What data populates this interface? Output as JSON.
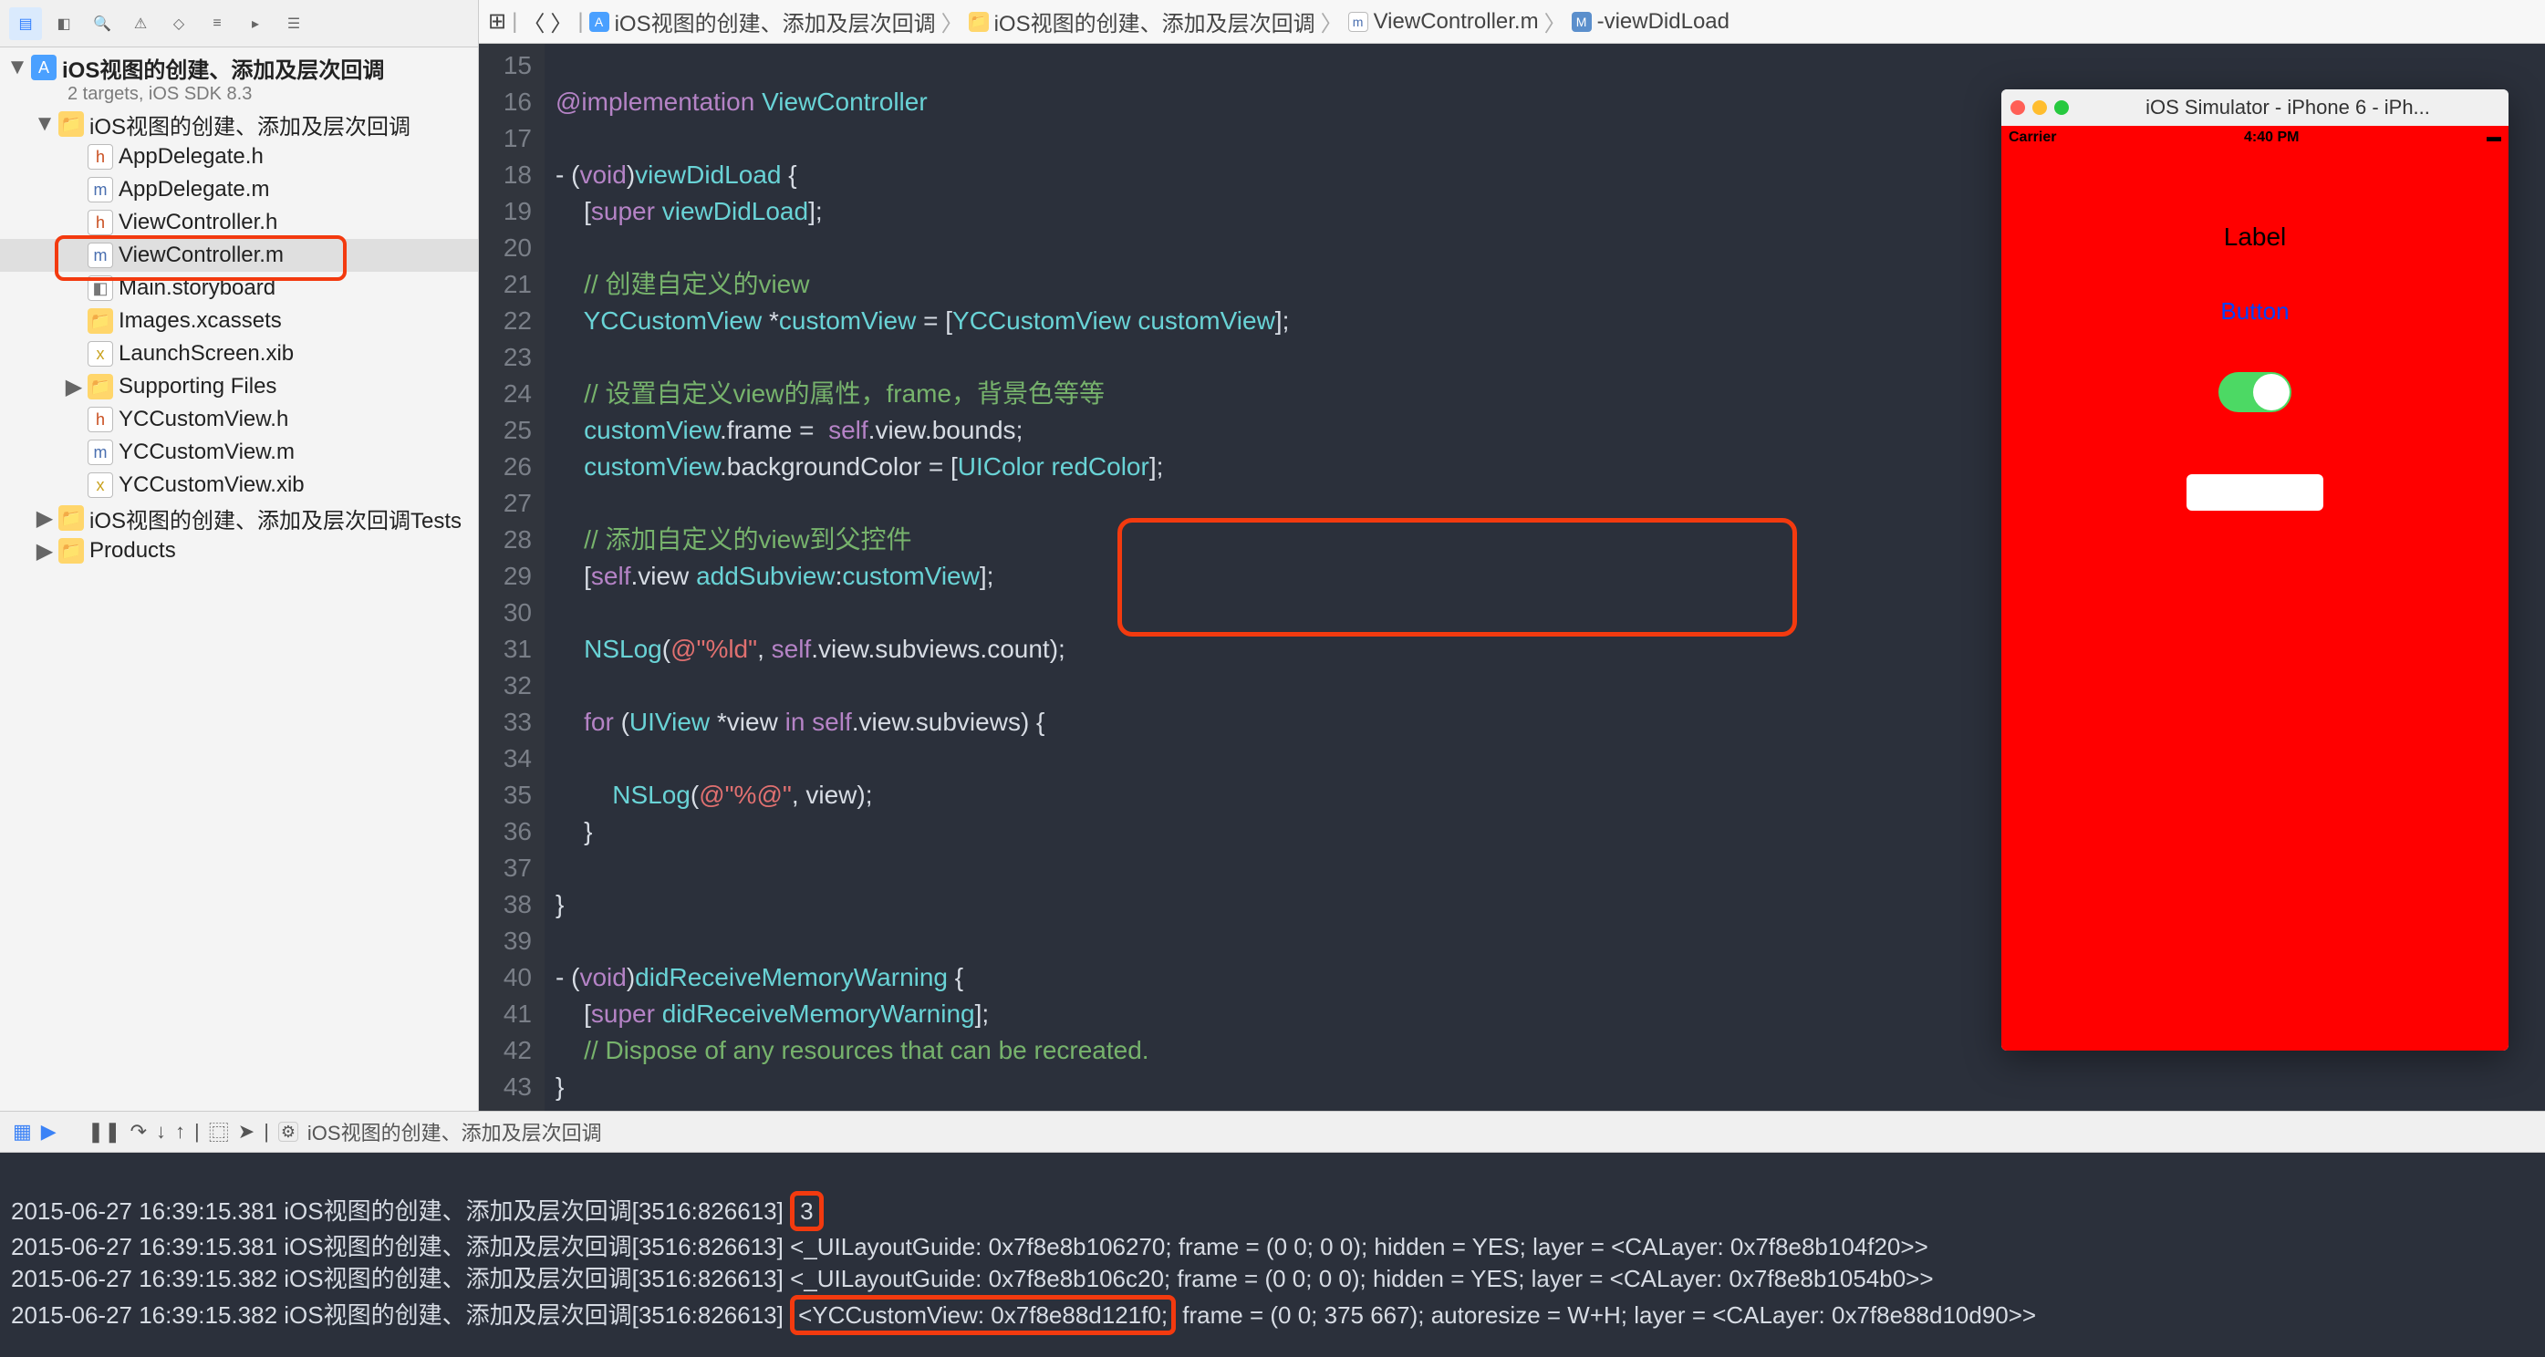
{
  "project": {
    "name": "iOS视图的创建、添加及层次回调",
    "subtitle": "2 targets, iOS SDK 8.3",
    "tree": {
      "root": "iOS视图的创建、添加及层次回调",
      "files": {
        "appdelegate_h": "AppDelegate.h",
        "appdelegate_m": "AppDelegate.m",
        "viewcontroller_h": "ViewController.h",
        "viewcontroller_m": "ViewController.m",
        "main_sb": "Main.storyboard",
        "images": "Images.xcassets",
        "launch": "LaunchScreen.xib",
        "supporting": "Supporting Files",
        "yc_h": "YCCustomView.h",
        "yc_m": "YCCustomView.m",
        "yc_xib": "YCCustomView.xib",
        "tests": "iOS视图的创建、添加及层次回调Tests",
        "products": "Products"
      }
    }
  },
  "jumpbar": {
    "item1": "iOS视图的创建、添加及层次回调",
    "item2": "iOS视图的创建、添加及层次回调",
    "item3": "ViewController.m",
    "item4": "-viewDidLoad"
  },
  "code": {
    "line_start": 15,
    "lines": [
      "",
      "@implementation ViewController",
      "",
      "- (void)viewDidLoad {",
      "    [super viewDidLoad];",
      "",
      "    // 创建自定义的view",
      "    YCCustomView *customView = [YCCustomView customView];",
      "",
      "    // 设置自定义view的属性，frame，背景色等等",
      "    customView.frame =  self.view.bounds;",
      "    customView.backgroundColor = [UIColor redColor];",
      "",
      "    // 添加自定义的view到父控件",
      "    [self.view addSubview:customView];",
      "",
      "    NSLog(@\"%ld\", self.view.subviews.count);",
      "",
      "    for (UIView *view in self.view.subviews) {",
      "",
      "        NSLog(@\"%@\", view);",
      "    }",
      "",
      "}",
      "",
      "- (void)didReceiveMemoryWarning {",
      "    [super didReceiveMemoryWarning];",
      "    // Dispose of any resources that can be recreated.",
      "}"
    ]
  },
  "simulator": {
    "title": "iOS Simulator - iPhone 6 - iPh...",
    "carrier": "Carrier",
    "time": "4:40 PM",
    "label": "Label",
    "button": "Button"
  },
  "debug": {
    "target": "iOS视图的创建、添加及层次回调"
  },
  "console": {
    "three": "3",
    "l1a": "2015-06-27 16:39:15.381 iOS视图的创建、添加及层次回调[3516:826613] ",
    "l2": "2015-06-27 16:39:15.381 iOS视图的创建、添加及层次回调[3516:826613] <_UILayoutGuide: 0x7f8e8b106270; frame = (0 0; 0 0); hidden = YES; layer = <CALayer: 0x7f8e8b104f20>>",
    "l3": "2015-06-27 16:39:15.382 iOS视图的创建、添加及层次回调[3516:826613] <_UILayoutGuide: 0x7f8e8b106c20; frame = (0 0; 0 0); hidden = YES; layer = <CALayer: 0x7f8e8b1054b0>>",
    "l4a": "2015-06-27 16:39:15.382 iOS视图的创建、添加及层次回调[3516:826613] ",
    "l4b": "<YCCustomView: 0x7f8e88d121f0;",
    "l4c": " frame = (0 0; 375 667); autoresize = W+H; layer = <CALayer: 0x7f8e88d10d90>>"
  }
}
